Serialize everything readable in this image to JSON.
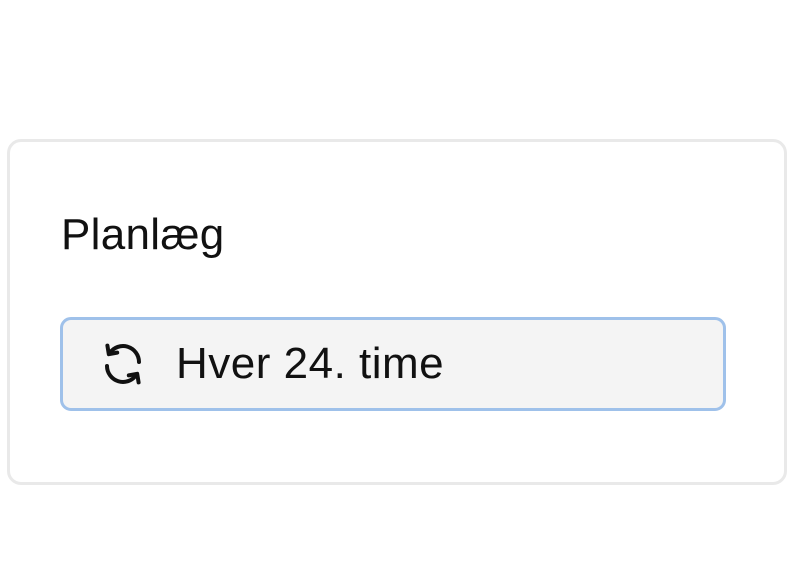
{
  "schedule_panel": {
    "title": "Planlæg",
    "frequency": {
      "icon": "refresh-icon",
      "value": "Hver 24. time"
    }
  },
  "colors": {
    "card_border": "#e9e9e9",
    "select_border": "#9fc1ea",
    "select_background": "#f4f4f4",
    "text": "#111111"
  }
}
